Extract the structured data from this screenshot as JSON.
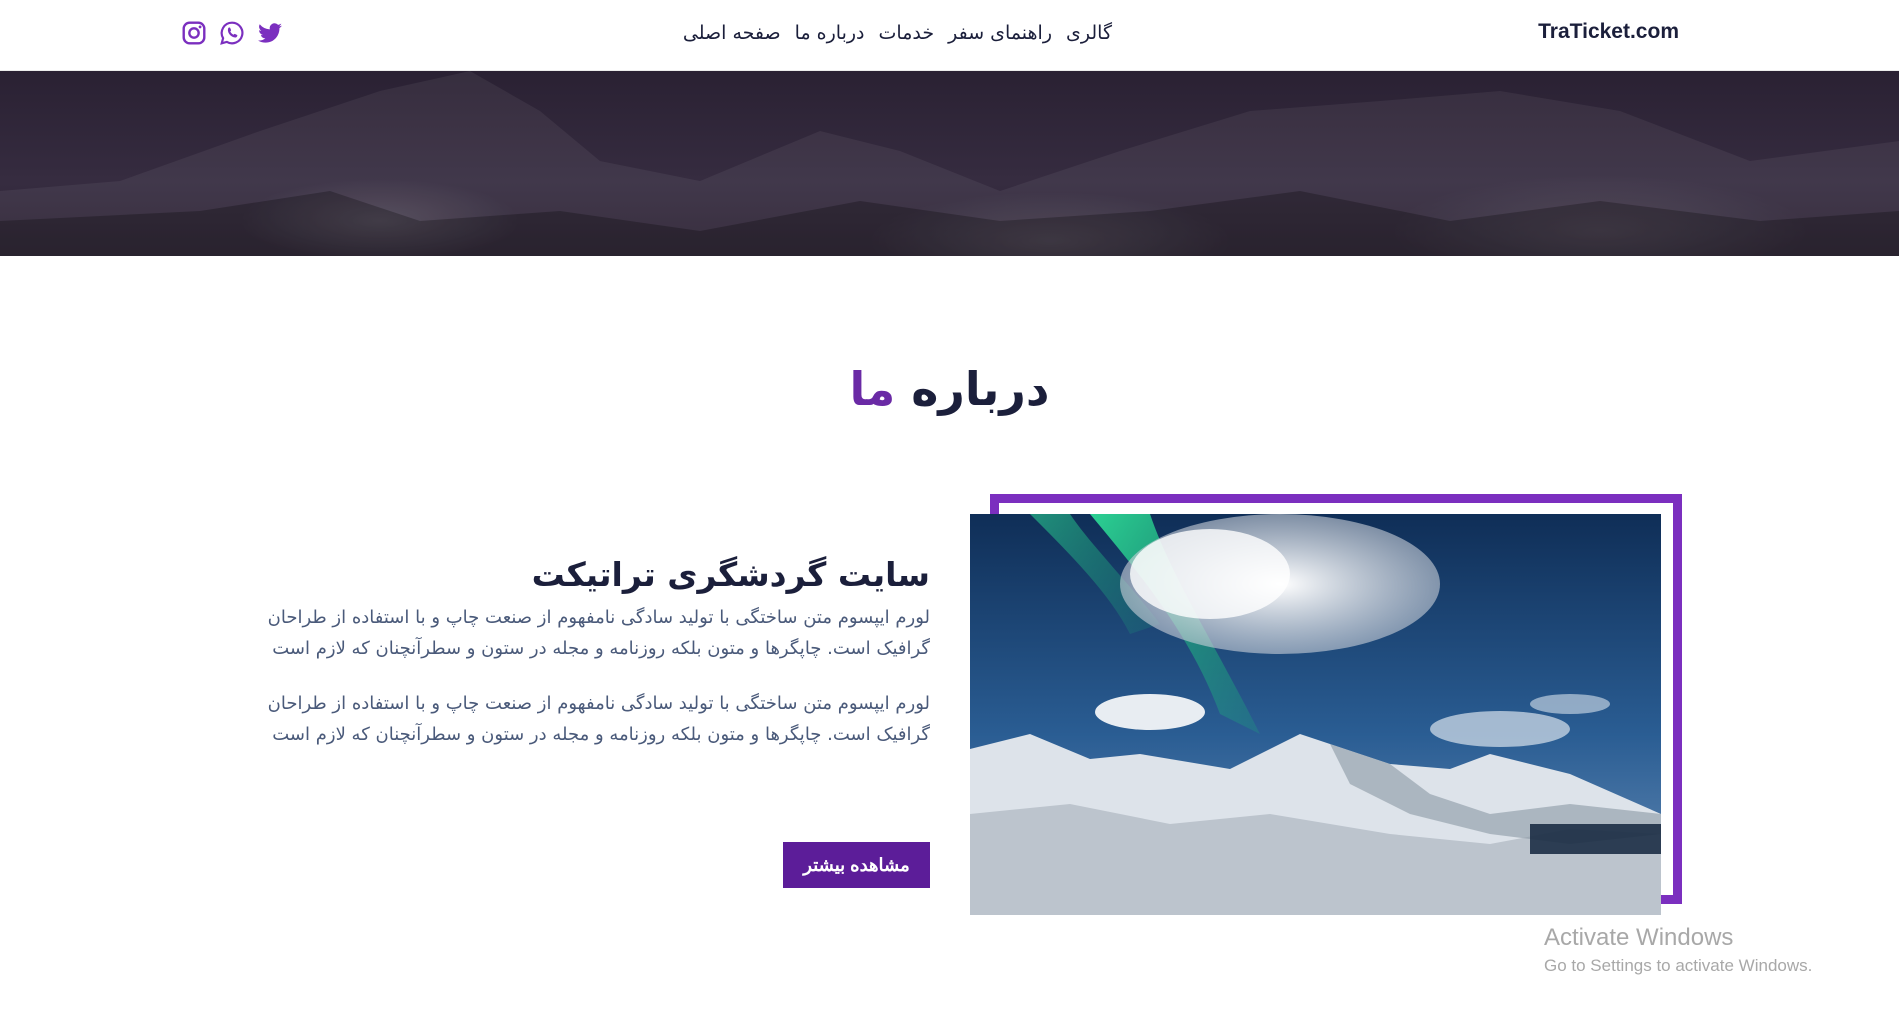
{
  "header": {
    "brand": "TraTicket.com",
    "nav": [
      {
        "label": "صفحه اصلی"
      },
      {
        "label": "درباره ما"
      },
      {
        "label": "خدمات"
      },
      {
        "label": "راهنمای سفر"
      },
      {
        "label": "گالری"
      }
    ],
    "socials": [
      {
        "icon": "twitter-icon"
      },
      {
        "icon": "whatsapp-icon"
      },
      {
        "icon": "instagram-icon"
      }
    ],
    "accent_color": "#7b2fbf"
  },
  "about": {
    "title_main": "درباره",
    "title_accent": "ما",
    "heading": "سایت گردشگری تراتیکت",
    "paragraphs": [
      "لورم ایپسوم متن ساختگی با تولید سادگی نامفهوم از صنعت چاپ و با استفاده از طراحان گرافیک است. چاپگرها و متون بلکه روزنامه و مجله در ستون و سطرآنچنان که لازم است",
      "لورم ایپسوم متن ساختگی با تولید سادگی نامفهوم از صنعت چاپ و با استفاده از طراحان گرافیک است. چاپگرها و متون بلکه روزنامه و مجله در ستون و سطرآنچنان که لازم است"
    ],
    "button_label": "مشاهده بیشتر"
  },
  "watermark": {
    "title": "Activate Windows",
    "subtitle": "Go to Settings to activate Windows."
  }
}
